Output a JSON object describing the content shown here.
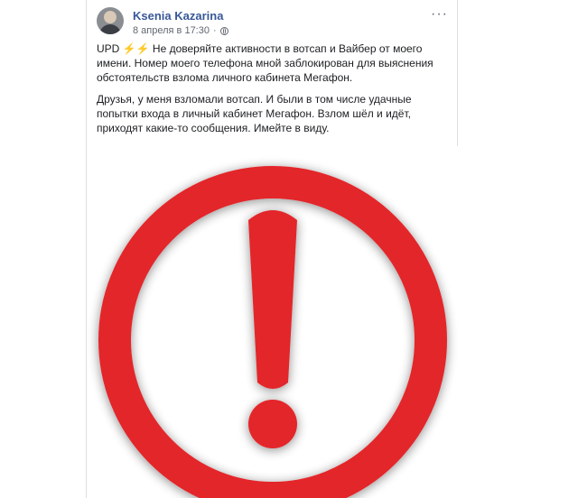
{
  "post": {
    "author": "Ksenia Kazarina",
    "date": "8 апреля в 17:30",
    "update_tag": "UPD",
    "update_emoji": "⚡⚡",
    "update_text": "Не доверяйте активности в вотсап и Вайбер от моего имени. Номер моего телефона мной заблокирован для выяснения обстоятельств взлома личного кабинета Мегафон.",
    "body_text": "Друзья, у меня взломали вотсап. И были в том числе удачные попытки входа в личный кабинет Мегафон. Взлом шёл и идёт, приходят какие-то сообщения. Имейте в виду.",
    "more_label": "···"
  },
  "image": {
    "icon": "exclamation-warning-icon",
    "color": "#e3262b"
  }
}
